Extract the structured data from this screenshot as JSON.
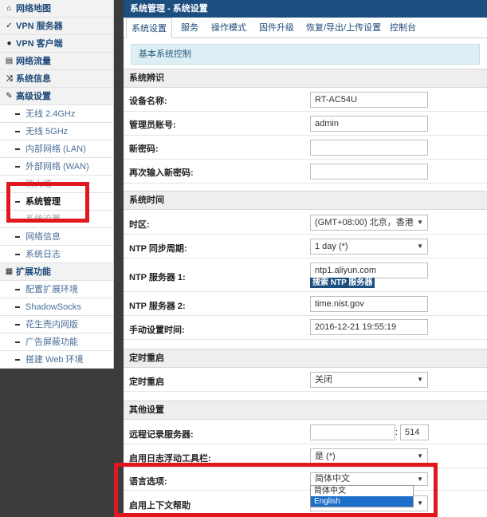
{
  "sidebar": {
    "items": [
      {
        "label": "网络地图",
        "type": "top",
        "icon": "home-icon",
        "glyph": "⌂"
      },
      {
        "label": "VPN 服务器",
        "type": "top",
        "icon": "vpn-server-icon",
        "glyph": "✓"
      },
      {
        "label": "VPN 客户端",
        "type": "top",
        "icon": "globe-icon",
        "glyph": "●"
      },
      {
        "label": "网络流量",
        "type": "top",
        "icon": "traffic-chart-icon",
        "glyph": "▤"
      },
      {
        "label": "系统信息",
        "type": "top",
        "icon": "shuffle-icon",
        "glyph": "⤨"
      },
      {
        "label": "高级设置",
        "type": "top",
        "icon": "wrench-icon",
        "glyph": "✎"
      },
      {
        "label": "无线 2.4GHz",
        "type": "sub"
      },
      {
        "label": "无线 5GHz",
        "type": "sub"
      },
      {
        "label": "内部网络 (LAN)",
        "type": "sub"
      },
      {
        "label": "外部网络 (WAN)",
        "type": "sub"
      },
      {
        "label": "防火墙",
        "type": "sub",
        "faded": true
      },
      {
        "label": "系统管理",
        "type": "sub",
        "active": true
      },
      {
        "label": "系统设置",
        "type": "sub",
        "faded": true
      },
      {
        "label": "网络信息",
        "type": "sub"
      },
      {
        "label": "系统日志",
        "type": "sub"
      },
      {
        "label": "扩展功能",
        "type": "top",
        "icon": "grid-icon",
        "glyph": "▦"
      },
      {
        "label": "配置扩展环境",
        "type": "sub"
      },
      {
        "label": "ShadowSocks",
        "type": "sub"
      },
      {
        "label": "花生壳内网版",
        "type": "sub"
      },
      {
        "label": "广告屏蔽功能",
        "type": "sub"
      },
      {
        "label": "搭建 Web 环境",
        "type": "sub"
      }
    ]
  },
  "main": {
    "title": "系统管理 - 系统设置",
    "tabs": [
      "系统设置",
      "服务",
      "操作模式",
      "固件升级",
      "恢复/导出/上传设置",
      "控制台"
    ],
    "info": "基本系统控制",
    "sections": {
      "identity": "系统辨识",
      "time": "系统时间",
      "reboot": "定时重启",
      "other": "其他设置"
    },
    "fields": {
      "device_name": {
        "label": "设备名称:",
        "value": "RT-AC54U"
      },
      "admin_account": {
        "label": "管理员账号:",
        "value": "admin"
      },
      "new_password": {
        "label": "新密码:",
        "value": ""
      },
      "confirm_password": {
        "label": "再次输入新密码:",
        "value": ""
      },
      "timezone": {
        "label": "时区:",
        "value": "(GMT+08:00) 北京，香港"
      },
      "ntp_period": {
        "label": "NTP 同步周期:",
        "value": "1 day (*)"
      },
      "ntp_server1": {
        "label": "NTP 服务器 1:",
        "value": "ntp1.aliyun.com",
        "button": "搜索 NTP 服务器"
      },
      "ntp_server2": {
        "label": "NTP 服务器 2:",
        "value": "time.nist.gov"
      },
      "manual_time": {
        "label": "手动设置时间:",
        "value": "2016-12-21 19:55:19"
      },
      "scheduled_reboot": {
        "label": "定时重启",
        "value": "关闭"
      },
      "remote_log": {
        "label": "远程记录服务器:",
        "value": "",
        "port": "514",
        "separator": ":"
      },
      "log_toolbar": {
        "label": "启用日志浮动工具栏:",
        "value": "是 (*)"
      },
      "language": {
        "label": "语言选项:",
        "value": "简体中文",
        "options": [
          "简体中文",
          "English"
        ],
        "highlighted": "English"
      },
      "context_help": {
        "label": "启用上下文帮助"
      }
    }
  },
  "colors": {
    "header_blue": "#1c4e80",
    "highlight_red": "#e0181e",
    "info_bg": "#ddeff5"
  }
}
